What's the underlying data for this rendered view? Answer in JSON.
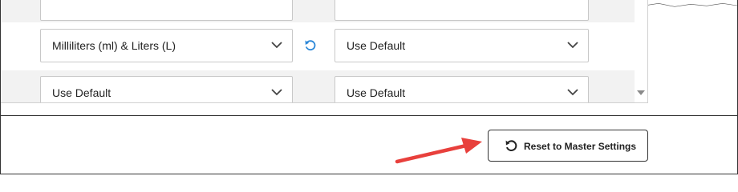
{
  "rows": [
    {
      "unit_select": {
        "value": ""
      },
      "override_select": {
        "value": ""
      },
      "has_reset": false
    },
    {
      "unit_select": {
        "value": "Milliliters (ml) & Liters (L)"
      },
      "override_select": {
        "value": "Use Default"
      },
      "has_reset": true
    },
    {
      "unit_select": {
        "value": "Use Default"
      },
      "override_select": {
        "value": "Use Default"
      },
      "has_reset": false
    }
  ],
  "footer": {
    "reset_master_label": "Reset to Master Settings"
  },
  "icons": {
    "chevron": "chevron-down-icon",
    "undo": "undo-icon",
    "scroll_down": "scroll-down-arrow-icon",
    "annotation": "red-arrow-annotation"
  },
  "colors": {
    "reset_link": "#2b87d8",
    "annotation_arrow": "#e8403c",
    "row_shade": "#f2f2f2"
  }
}
